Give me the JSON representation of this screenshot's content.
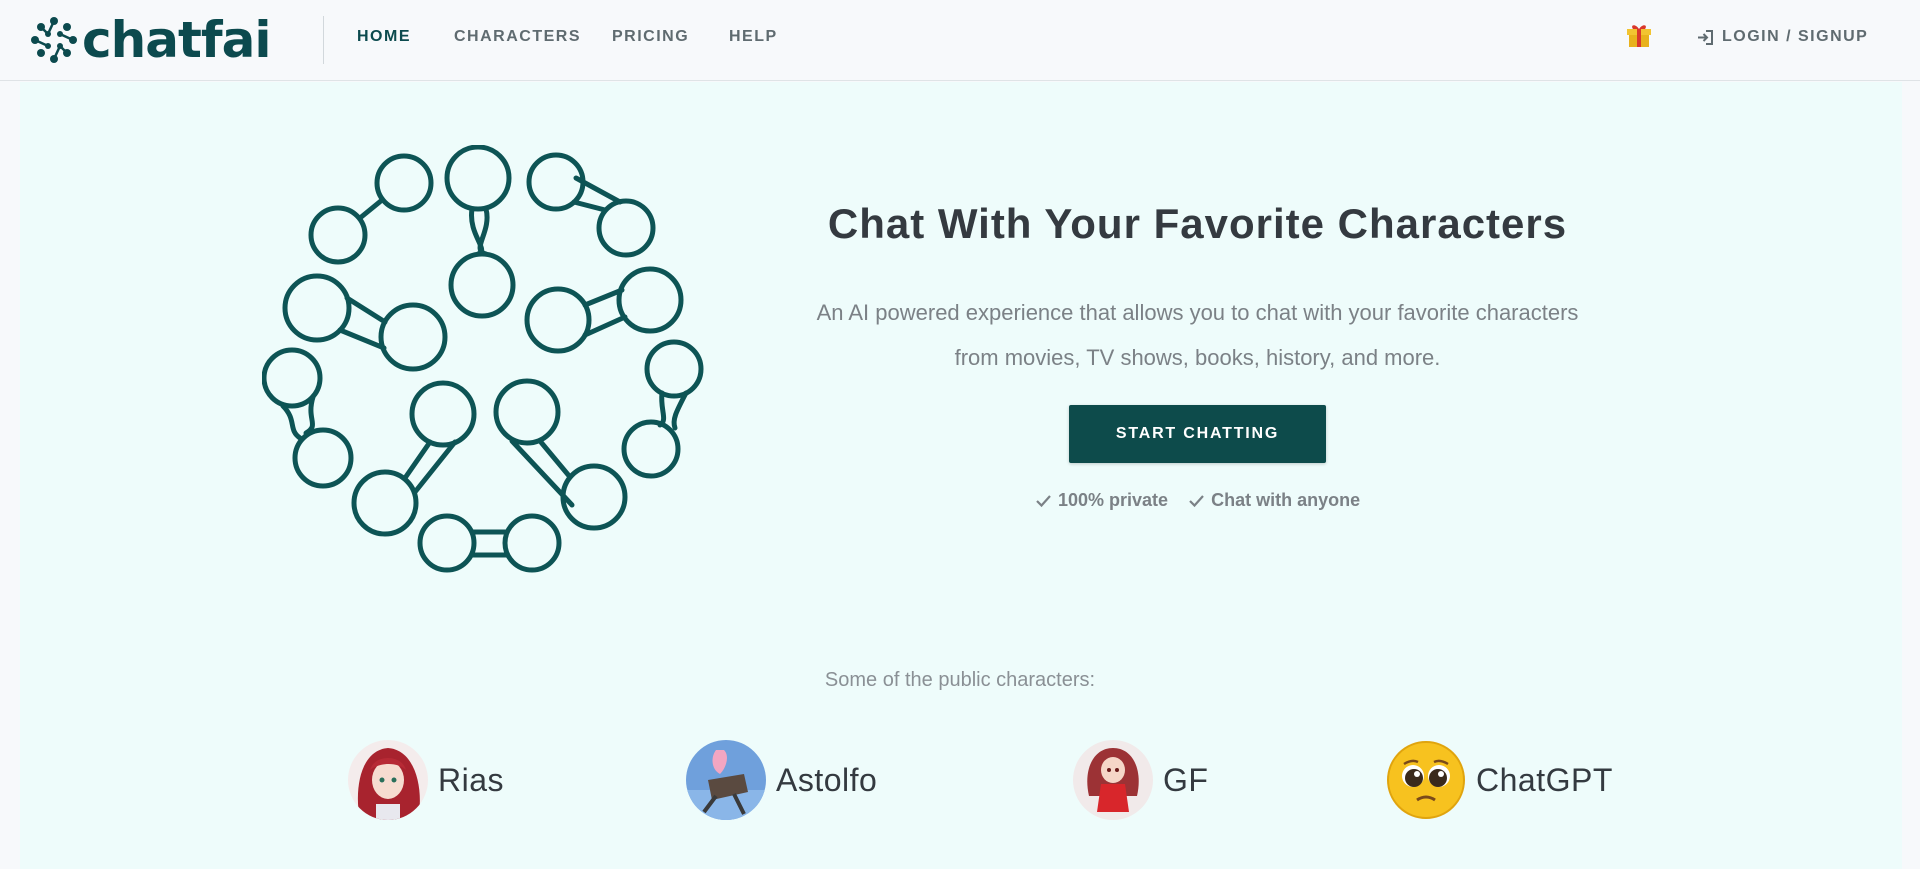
{
  "brand": {
    "name": "chatfai",
    "color": "#0c4a4e"
  },
  "nav": {
    "links": [
      {
        "label": "HOME",
        "active": true
      },
      {
        "label": "CHARACTERS",
        "active": false
      },
      {
        "label": "PRICING",
        "active": false
      },
      {
        "label": "HELP",
        "active": false
      }
    ],
    "gift_icon": "gift-icon",
    "login_label": "LOGIN / SIGNUP",
    "login_icon": "sign-in-icon"
  },
  "hero": {
    "title": "Chat With Your Favorite Characters",
    "description_line1": "An AI powered experience that allows you to chat with your favorite characters",
    "description_line2": "from movies, TV shows, books, history, and more.",
    "cta_label": "START CHATTING",
    "features": [
      "100% private",
      "Chat with anyone"
    ],
    "accent_color": "#0d4b4b",
    "background": "#eefcfb"
  },
  "public_characters": {
    "label": "Some of the public characters:",
    "items": [
      {
        "name": "Rias",
        "avatar": "rias-avatar"
      },
      {
        "name": "Astolfo",
        "avatar": "astolfo-avatar"
      },
      {
        "name": "GF",
        "avatar": "gf-avatar"
      },
      {
        "name": "ChatGPT",
        "avatar": "pleading-face-emoji"
      }
    ]
  }
}
